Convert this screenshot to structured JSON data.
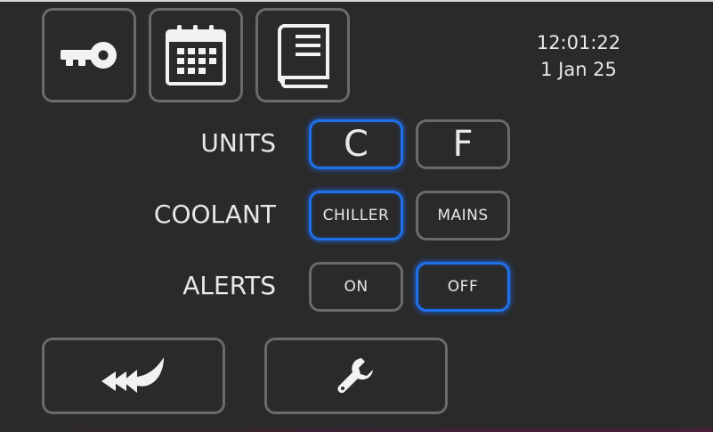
{
  "header": {
    "time": "12:01:22",
    "date": "1 Jan 25",
    "icons": [
      "key-icon",
      "calendar-icon",
      "book-icon"
    ]
  },
  "settings": {
    "units": {
      "label": "UNITS",
      "options": [
        "C",
        "F"
      ],
      "selected": "C"
    },
    "coolant": {
      "label": "COOLANT",
      "options": [
        "CHILLER",
        "MAINS"
      ],
      "selected": "CHILLER"
    },
    "alerts": {
      "label": "ALERTS",
      "options": [
        "ON",
        "OFF"
      ],
      "selected": "OFF"
    }
  },
  "footer": {
    "icons": [
      "back-arrow-icon",
      "wrench-icon"
    ]
  },
  "colors": {
    "background": "#2a2a2a",
    "border": "#6a6a6a",
    "accent": "#1f6fe8",
    "text": "#e8e8e8"
  }
}
